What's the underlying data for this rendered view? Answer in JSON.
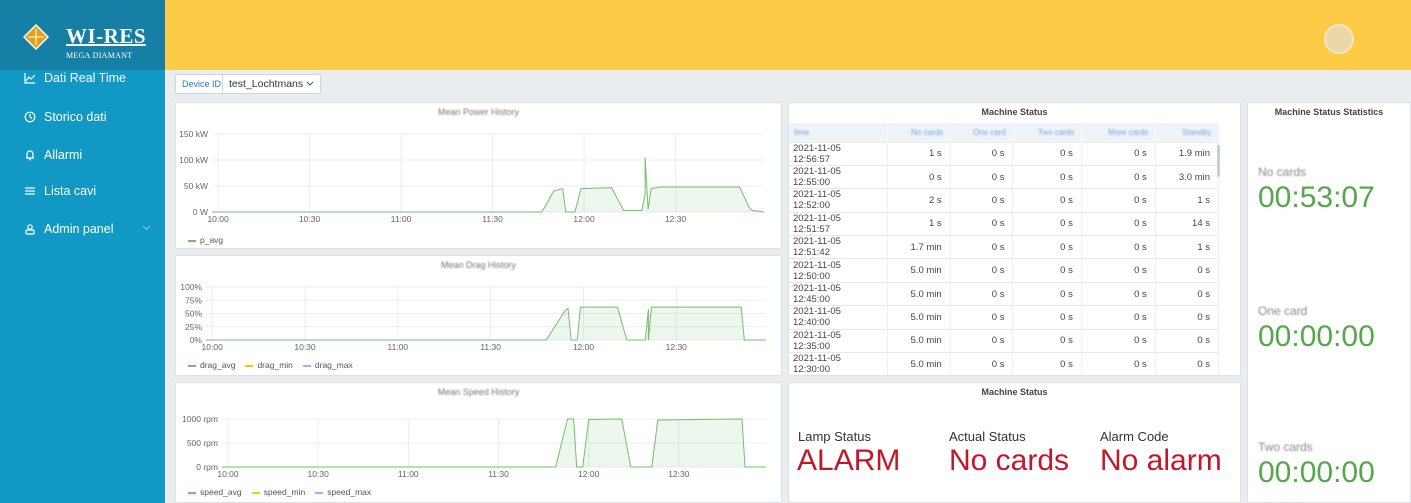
{
  "brand": {
    "name": "WI-RES",
    "sub": "MEGA DIAMANT"
  },
  "sidebar": {
    "items": [
      {
        "label": "Dati Real Time",
        "icon": "chart-line-icon"
      },
      {
        "label": "Storico dati",
        "icon": "history-icon"
      },
      {
        "label": "Allarmi",
        "icon": "bell-icon"
      },
      {
        "label": "Lista cavi",
        "icon": "list-icon"
      },
      {
        "label": "Admin panel",
        "icon": "users-icon"
      }
    ]
  },
  "device": {
    "label": "Device ID",
    "value": "test_Lochtmans"
  },
  "charts": {
    "power": {
      "title": "Mean Power History",
      "yticks": [
        "150 kW",
        "100 kW",
        "50 kW",
        "0 W"
      ],
      "xticks": [
        "10:00",
        "10:30",
        "11:00",
        "11:30",
        "12:00",
        "12:30"
      ],
      "legend": [
        "p_avg"
      ]
    },
    "drag": {
      "title": "Mean Drag History",
      "yticks": [
        "100%",
        "75%",
        "50%",
        "25%",
        "0%"
      ],
      "xticks": [
        "10:00",
        "10:30",
        "11:00",
        "11:30",
        "12:00",
        "12:30"
      ],
      "legend": [
        "drag_avg",
        "drag_min",
        "drag_max"
      ]
    },
    "speed": {
      "title": "Mean Speed History",
      "yticks": [
        "1000 rpm",
        "500 rpm",
        "0 rpm"
      ],
      "xticks": [
        "10:00",
        "10:30",
        "11:00",
        "11:30",
        "12:00",
        "12:30"
      ],
      "legend": [
        "speed_avg",
        "speed_min",
        "speed_max"
      ]
    }
  },
  "chart_data": [
    {
      "type": "area",
      "ylabel": "",
      "xlabel": "",
      "ylim": [
        0,
        150
      ],
      "unit": "kW",
      "x_range": [
        "09:58",
        "12:59"
      ],
      "series": [
        {
          "name": "p_avg",
          "color": "#73bf69",
          "points": [
            [
              "09:58",
              0
            ],
            [
              "11:46",
              0
            ],
            [
              "11:47",
              8
            ],
            [
              "11:50",
              40
            ],
            [
              "11:51",
              42
            ],
            [
              "11:53",
              45
            ],
            [
              "11:54",
              0
            ],
            [
              "11:57",
              0
            ],
            [
              "11:59",
              45
            ],
            [
              "12:09",
              47
            ],
            [
              "12:13",
              3
            ],
            [
              "12:19",
              3
            ],
            [
              "12:20",
              35
            ],
            [
              "12:20",
              105
            ],
            [
              "12:21",
              5
            ],
            [
              "12:22",
              45
            ],
            [
              "12:25",
              48
            ],
            [
              "12:51",
              48
            ],
            [
              "12:54",
              10
            ],
            [
              "12:55",
              3
            ],
            [
              "12:59",
              0
            ]
          ]
        }
      ]
    },
    {
      "type": "area",
      "ylim": [
        0,
        100
      ],
      "unit": "%",
      "x_range": [
        "09:58",
        "12:59"
      ],
      "series": [
        {
          "name": "drag_avg",
          "color": "#73bf69",
          "points": [
            [
              "09:58",
              0
            ],
            [
              "11:48",
              0
            ],
            [
              "11:54",
              55
            ],
            [
              "11:55",
              60
            ],
            [
              "11:56",
              0
            ],
            [
              "11:58",
              0
            ],
            [
              "11:59",
              62
            ],
            [
              "12:11",
              62
            ],
            [
              "12:14",
              0
            ],
            [
              "12:20",
              0
            ],
            [
              "12:21",
              58
            ],
            [
              "12:21",
              0
            ],
            [
              "12:22",
              62
            ],
            [
              "12:51",
              62
            ],
            [
              "12:52",
              0
            ],
            [
              "12:59",
              0
            ]
          ]
        },
        {
          "name": "drag_min",
          "color": "#f2cc0c",
          "points": []
        },
        {
          "name": "drag_max",
          "color": "#8ab8ff",
          "points": []
        }
      ]
    },
    {
      "type": "area",
      "ylim": [
        0,
        1000
      ],
      "unit": "rpm",
      "x_range": [
        "09:58",
        "12:59"
      ],
      "series": [
        {
          "name": "speed_avg",
          "color": "#73bf69",
          "points": [
            [
              "09:58",
              0
            ],
            [
              "11:49",
              0
            ],
            [
              "11:53",
              1000
            ],
            [
              "11:55",
              1000
            ],
            [
              "11:56",
              0
            ],
            [
              "11:58",
              0
            ],
            [
              "12:00",
              990
            ],
            [
              "12:11",
              1000
            ],
            [
              "12:14",
              0
            ],
            [
              "12:21",
              0
            ],
            [
              "12:23",
              980
            ],
            [
              "12:51",
              1000
            ],
            [
              "12:52",
              0
            ],
            [
              "12:59",
              0
            ]
          ]
        },
        {
          "name": "speed_min",
          "color": "#f2cc0c",
          "points": []
        },
        {
          "name": "speed_max",
          "color": "#8ab8ff",
          "points": []
        }
      ]
    }
  ],
  "machine_table": {
    "title": "Machine Status",
    "columns": [
      "time",
      "No cards",
      "One card",
      "Two cards",
      "More cards",
      "Standby"
    ],
    "rows": [
      [
        "2021-11-05 12:56:57",
        "1 s",
        "0 s",
        "0 s",
        "0 s",
        "1.9 min"
      ],
      [
        "2021-11-05 12:55:00",
        "0 s",
        "0 s",
        "0 s",
        "0 s",
        "3.0 min"
      ],
      [
        "2021-11-05 12:52:00",
        "2 s",
        "0 s",
        "0 s",
        "0 s",
        "1 s"
      ],
      [
        "2021-11-05 12:51:57",
        "1 s",
        "0 s",
        "0 s",
        "0 s",
        "14 s"
      ],
      [
        "2021-11-05 12:51:42",
        "1.7 min",
        "0 s",
        "0 s",
        "0 s",
        "1 s"
      ],
      [
        "2021-11-05 12:50:00",
        "5.0 min",
        "0 s",
        "0 s",
        "0 s",
        "0 s"
      ],
      [
        "2021-11-05 12:45:00",
        "5.0 min",
        "0 s",
        "0 s",
        "0 s",
        "0 s"
      ],
      [
        "2021-11-05 12:40:00",
        "5.0 min",
        "0 s",
        "0 s",
        "0 s",
        "0 s"
      ],
      [
        "2021-11-05 12:35:00",
        "5.0 min",
        "0 s",
        "0 s",
        "0 s",
        "0 s"
      ],
      [
        "2021-11-05 12:30:00",
        "5.0 min",
        "0 s",
        "0 s",
        "0 s",
        "0 s"
      ]
    ]
  },
  "machine_status": {
    "title": "Machine Status",
    "lamp_label": "Lamp Status",
    "lamp_value": "ALARM",
    "actual_label": "Actual Status",
    "actual_value": "No cards",
    "alarm_label": "Alarm Code",
    "alarm_value": "No alarm",
    "value_color": "#c4162a"
  },
  "stats": {
    "title": "Machine Status Statistics",
    "items": [
      {
        "label": "No cards",
        "value": "00:53:07"
      },
      {
        "label": "One card",
        "value": "00:00:00"
      },
      {
        "label": "Two cards",
        "value": "00:00:00"
      }
    ],
    "value_color": "#56a64b"
  }
}
